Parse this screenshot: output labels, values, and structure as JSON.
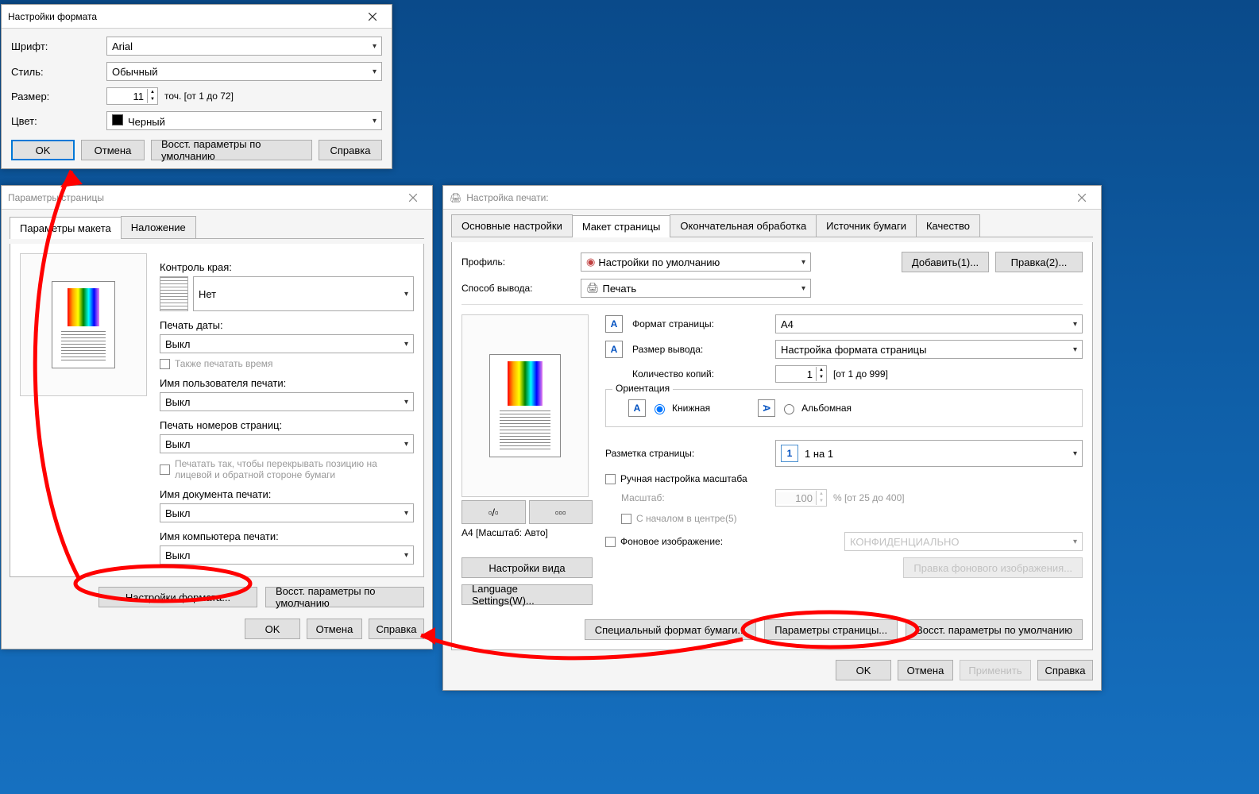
{
  "format_dialog": {
    "title": "Настройки формата",
    "font_label": "Шрифт:",
    "font_value": "Arial",
    "style_label": "Стиль:",
    "style_value": "Обычный",
    "size_label": "Размер:",
    "size_value": "11",
    "size_hint": "точ. [от 1 до 72]",
    "color_label": "Цвет:",
    "color_value": "Черный",
    "ok": "OK",
    "cancel": "Отмена",
    "restore": "Восст. параметры по умолчанию",
    "help": "Справка"
  },
  "page_params": {
    "title": "Параметры страницы",
    "tab_layout": "Параметры макета",
    "tab_overlay": "Наложение",
    "edge_label": "Контроль края:",
    "edge_value": "Нет",
    "date_label": "Печать даты:",
    "date_value": "Выкл",
    "also_time": "Также печатать время",
    "user_label": "Имя пользователя печати:",
    "user_value": "Выкл",
    "pagenum_label": "Печать номеров страниц:",
    "pagenum_value": "Выкл",
    "overlap_checkbox": "Печатать так, чтобы перекрывать позицию на лицевой и обратной стороне бумаги",
    "docname_label": "Имя документа печати:",
    "docname_value": "Выкл",
    "compname_label": "Имя компьютера печати:",
    "compname_value": "Выкл",
    "format_settings": "Настройки формата...",
    "restore": "Восст. параметры по умолчанию",
    "ok": "OK",
    "cancel": "Отмена",
    "help": "Справка"
  },
  "print_settings": {
    "title": "Настройка печати:",
    "tabs": {
      "main": "Основные настройки",
      "layout": "Макет страницы",
      "finishing": "Окончательная обработка",
      "source": "Источник бумаги",
      "quality": "Качество"
    },
    "profile_label": "Профиль:",
    "profile_value": "Настройки по умолчанию",
    "add_btn": "Добавить(1)...",
    "edit_btn": "Правка(2)...",
    "output_label": "Способ вывода:",
    "output_value": "Печать",
    "page_format_label": "Формат страницы:",
    "page_format_value": "A4",
    "out_size_label": "Размер вывода:",
    "out_size_value": "Настройка формата страницы",
    "copies_label": "Количество копий:",
    "copies_value": "1",
    "copies_hint": "[от 1 до 999]",
    "orientation_label": "Ориентация",
    "portrait": "Книжная",
    "landscape": "Альбомная",
    "pagelayout_label": "Разметка страницы:",
    "pagelayout_value": "1 на 1",
    "manual_scale": "Ручная настройка масштаба",
    "scale_label": "Масштаб:",
    "scale_value": "100",
    "scale_hint": "% [от 25 до 400]",
    "center_start": "С началом в центре(5)",
    "bg_image": "Фоновое изображение:",
    "bg_value": "КОНФИДЕНЦИАЛЬНО",
    "bg_edit": "Правка фонового изображения...",
    "preview_caption": "A4 [Масштаб: Авто]",
    "view_settings": "Настройки вида",
    "lang_settings": "Language Settings(W)...",
    "special_paper": "Специальный формат бумаги...",
    "page_params_btn": "Параметры страницы...",
    "restore": "Восст. параметры по умолчанию",
    "ok": "OK",
    "cancel": "Отмена",
    "apply": "Применить",
    "help": "Справка"
  }
}
